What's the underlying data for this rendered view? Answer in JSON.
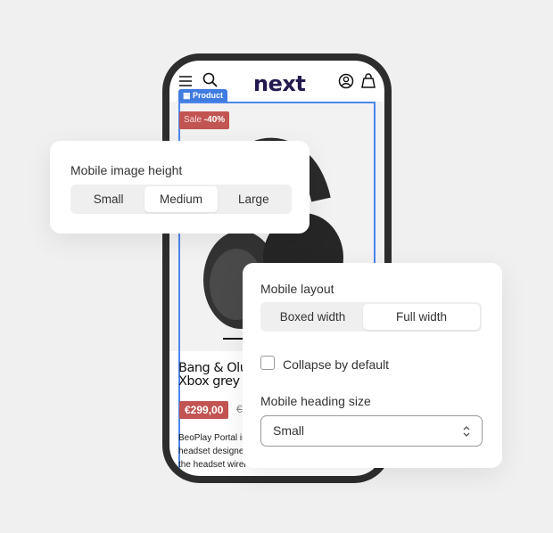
{
  "phone": {
    "logo": "next",
    "header_icons": [
      "menu-icon",
      "search-icon",
      "account-icon",
      "bag-icon"
    ],
    "block_tab": "Product",
    "sale_badge": {
      "prefix": "Sale",
      "value": "-40%"
    },
    "product_title": [
      "Bang & Oluf",
      "Xbox grey"
    ],
    "price": "€299,00",
    "old_price": "€",
    "description": [
      "BeoPlay Portal is",
      "headset designe",
      "the headset wirel"
    ]
  },
  "image_height_card": {
    "label": "Mobile image height",
    "options": [
      "Small",
      "Medium",
      "Large"
    ],
    "selected": "Medium"
  },
  "layout_card": {
    "label": "Mobile layout",
    "options": [
      "Boxed width",
      "Full width"
    ],
    "selected": "Full width",
    "collapse_label": "Collapse by default",
    "collapse_checked": false,
    "heading_label": "Mobile heading size",
    "heading_value": "Small"
  },
  "colors": {
    "accent": "#3f7be0",
    "sale": "#c25552",
    "logo": "#241a4f"
  }
}
